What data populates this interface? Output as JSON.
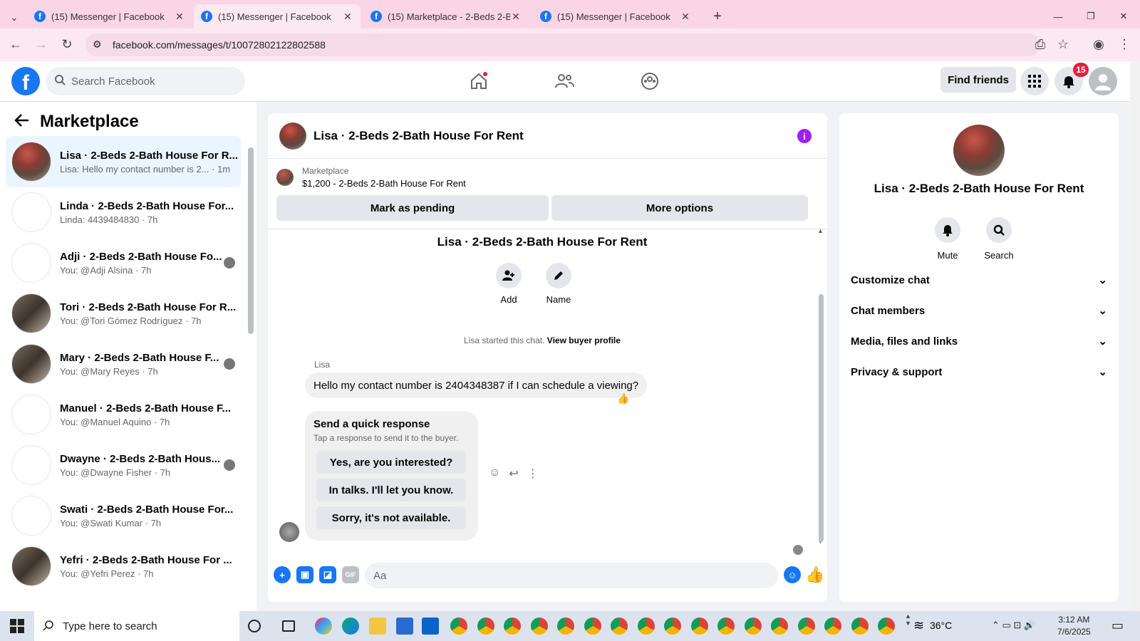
{
  "browser": {
    "tabs": [
      {
        "title": "(15) Messenger | Facebook",
        "active": false
      },
      {
        "title": "(15) Messenger | Facebook",
        "active": true
      },
      {
        "title": "(15) Marketplace - 2-Beds 2-Ba",
        "active": false
      },
      {
        "title": "(15) Messenger | Facebook",
        "active": false
      }
    ],
    "url": "facebook.com/messages/t/10072802122802588"
  },
  "header": {
    "search_placeholder": "Search Facebook",
    "find_friends": "Find friends",
    "notif_count": "15"
  },
  "sidebar": {
    "title": "Marketplace",
    "conversations": [
      {
        "name": "Lisa · 2-Beds 2-Bath House For R...",
        "sub": "Lisa: Hello my contact number is 2... · 1m",
        "avatar": "photo",
        "selected": true
      },
      {
        "name": "Linda · 2-Beds 2-Bath House For...",
        "sub": "Linda: 4439484830 · 7h",
        "avatar": "empty"
      },
      {
        "name": "Adji · 2-Beds 2-Bath House Fo...",
        "sub": "You: @Adji Alsina · 7h",
        "avatar": "empty",
        "seen": true
      },
      {
        "name": "Tori · 2-Beds 2-Bath House For R...",
        "sub": "You: @Tori Gómez Rodríguez · 7h",
        "avatar": "photo2"
      },
      {
        "name": "Mary · 2-Beds 2-Bath House F...",
        "sub": "You: @Mary Reyes · 7h",
        "avatar": "photo2",
        "seen": true
      },
      {
        "name": "Manuel · 2-Beds 2-Bath House F...",
        "sub": "You: @Manuel Aquino · 7h",
        "avatar": "empty"
      },
      {
        "name": "Dwayne · 2-Beds 2-Bath Hous...",
        "sub": "You: @Dwayne Fisher · 7h",
        "avatar": "empty",
        "seen": true
      },
      {
        "name": "Swati · 2-Beds 2-Bath House For...",
        "sub": "You: @Swati Kumar · 7h",
        "avatar": "empty"
      },
      {
        "name": "Yefri · 2-Beds 2-Bath House For ...",
        "sub": "You: @Yefri Perez · 7h",
        "avatar": "photo2"
      }
    ]
  },
  "chat": {
    "title": "Lisa · 2-Beds 2-Bath House For Rent",
    "listing_label": "Marketplace",
    "listing_title": "$1,200 - 2-Beds 2-Bath House For Rent",
    "mark_pending": "Mark as pending",
    "more_options": "More options",
    "thread_title": "Lisa · 2-Beds 2-Bath House For Rent",
    "add_label": "Add",
    "name_label": "Name",
    "started_text": "Lisa started this chat.",
    "view_buyer": "View buyer profile",
    "sender": "Lisa",
    "message": "Hello my contact number is 2404348387 if I can schedule a viewing?",
    "reaction": "👍",
    "quick_title": "Send a quick response",
    "quick_sub": "Tap a response to send it to the buyer.",
    "quick_responses": [
      "Yes, are you interested?",
      "In talks. I'll let you know.",
      "Sorry, it's not available."
    ],
    "input_placeholder": "Aa"
  },
  "details": {
    "name": "Lisa · 2-Beds 2-Bath House For Rent",
    "mute": "Mute",
    "search": "Search",
    "sections": [
      "Customize chat",
      "Chat members",
      "Media, files and links",
      "Privacy & support"
    ]
  },
  "taskbar": {
    "search_placeholder": "Type here to search",
    "temperature": "36°C",
    "time": "3:12 AM",
    "date": "7/6/2025"
  },
  "colors": {
    "brand": "#1877f2",
    "accent": "#a020f0",
    "badge": "#e41e3f"
  }
}
